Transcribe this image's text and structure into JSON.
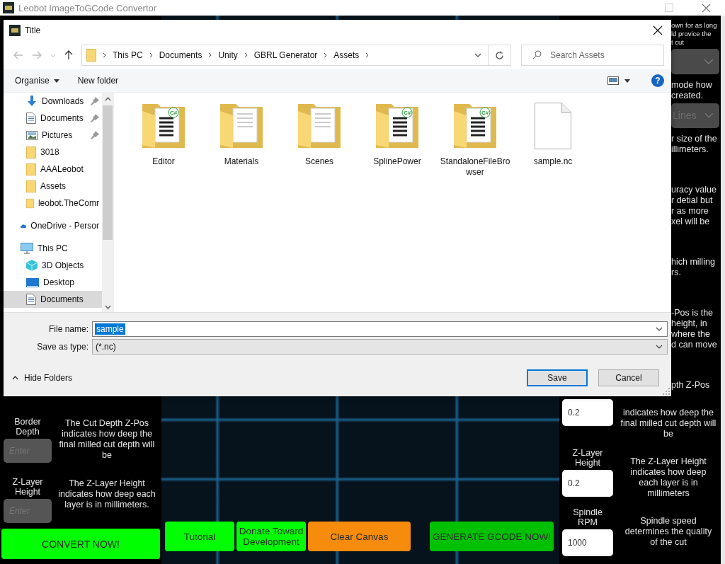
{
  "app": {
    "title": "Leobot ImageToGCode Convertor"
  },
  "left_panel": {
    "rows": [
      {
        "label": "Border Depth",
        "placeholder": "Enter",
        "description": "The Cut Depth Z-Pos indicates how deep the final milled cut depth will be"
      },
      {
        "label": "Z-Layer Height",
        "placeholder": "Enter",
        "description": "The Z-Layer Height indicates how deep each layer is in millimeters."
      }
    ],
    "convert_button": "CONVERT NOW!"
  },
  "toolbar_buttons": [
    {
      "label": "Tutorial",
      "color": "#00ff00"
    },
    {
      "label": "Donate Toward Development",
      "color": "#00ff00"
    },
    {
      "label": "Clear Canvas",
      "color": "#f68b0c"
    },
    {
      "label": "GENERATE GCODE NOW!",
      "color": "#00c000"
    }
  ],
  "right_panel": {
    "fragments": [
      {
        "kind": "text",
        "lines": [
          "own for as long",
          "ld provice the",
          "t cut"
        ]
      },
      {
        "kind": "dropdown"
      },
      {
        "kind": "text",
        "lines": [
          "mode how",
          "created."
        ]
      },
      {
        "kind": "dropdown",
        "value": "Lines"
      },
      {
        "kind": "text",
        "lines": [
          "r size of the",
          "illimeters."
        ]
      },
      {
        "kind": "text",
        "lines": [
          "uracy value",
          "r detial but",
          "r as more",
          "xel will be"
        ]
      },
      {
        "kind": "text",
        "lines": [
          "hich milling",
          "rs."
        ]
      },
      {
        "kind": "text",
        "lines": [
          "-Pos is the",
          "height, in",
          "where the",
          "d can move"
        ]
      },
      {
        "kind": "text",
        "lines": [
          "pth Z-Pos"
        ]
      }
    ],
    "rows": [
      {
        "value": "0.2",
        "description": "indicates how deep the final milled cut depth will be"
      },
      {
        "label": "Z-Layer Height",
        "value": "0.2",
        "description": "The Z-Layer Height indicates how deep each layer is in millimeters"
      },
      {
        "label": "Spindle RPM",
        "value": "1000",
        "description": "Spindle speed determines the quality of the cut"
      }
    ]
  },
  "dialog": {
    "title": "Title",
    "path": [
      "This PC",
      "Documents",
      "Unity",
      "GBRL Generator",
      "Assets"
    ],
    "search_placeholder": "Search Assets",
    "organise": "Organise",
    "new_folder": "New folder",
    "help_button": "?",
    "sidebar": [
      {
        "label": "Downloads",
        "kind": "item",
        "pinned": true,
        "selected": false
      },
      {
        "label": "Documents",
        "kind": "item",
        "pinned": true,
        "selected": false
      },
      {
        "label": "Pictures",
        "kind": "item",
        "pinned": true,
        "selected": false
      },
      {
        "label": "3018",
        "kind": "item",
        "pinned": false,
        "selected": false
      },
      {
        "label": "AAALeobot",
        "kind": "item",
        "pinned": false,
        "selected": false
      },
      {
        "label": "Assets",
        "kind": "item",
        "pinned": false,
        "selected": false
      },
      {
        "label": "leobot.TheComr",
        "kind": "item",
        "pinned": false,
        "selected": false
      },
      {
        "label": "OneDrive - Persor",
        "kind": "root",
        "pinned": false,
        "selected": false
      },
      {
        "label": "This PC",
        "kind": "root",
        "pinned": false,
        "selected": false,
        "children": [
          {
            "label": "3D Objects",
            "pinned": false,
            "selected": false
          },
          {
            "label": "Desktop",
            "pinned": false,
            "selected": false
          },
          {
            "label": "Documents",
            "pinned": false,
            "selected": true
          }
        ]
      }
    ],
    "files": [
      {
        "name": "Editor",
        "kind": "folder",
        "badge": "C#"
      },
      {
        "name": "Materials",
        "kind": "folder"
      },
      {
        "name": "Scenes",
        "kind": "folder"
      },
      {
        "name": "SplinePower",
        "kind": "folder",
        "badge": "C#"
      },
      {
        "name": "StandaloneFileBrowser",
        "kind": "folder",
        "badge": "C#"
      },
      {
        "name": "sample.nc",
        "kind": "file"
      }
    ],
    "file_name_label": "File name:",
    "file_name": "sample",
    "save_as_type_label": "Save as type:",
    "save_as_type": "(*.nc)",
    "hide_folders": "Hide Folders",
    "save": "Save",
    "cancel": "Cancel"
  }
}
